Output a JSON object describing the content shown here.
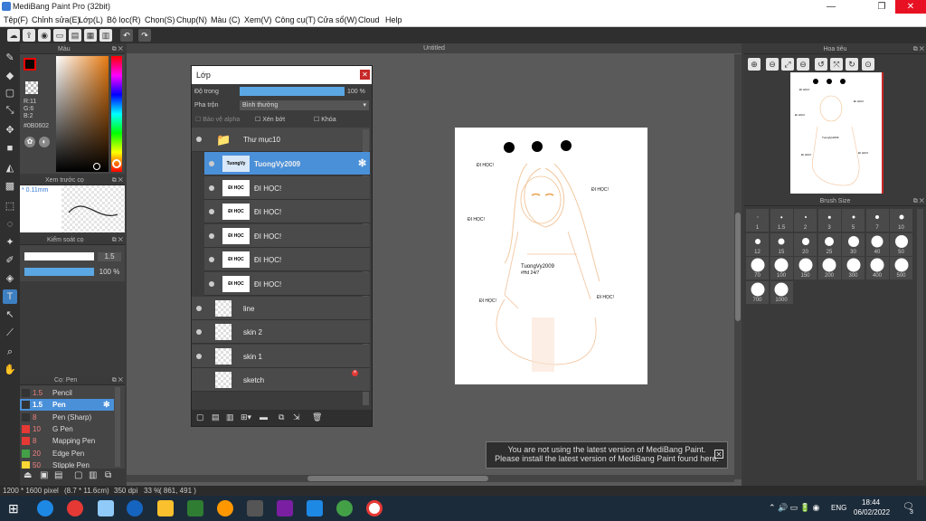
{
  "window": {
    "title": "MediBang Paint Pro (32bit)",
    "min": "—",
    "max": "❐",
    "close": "✕"
  },
  "menu": [
    "Tệp(F)",
    "Chỉnh sửa(E)",
    "Lớp(L)",
    "Bộ lọc(R)",
    "Chọn(S)",
    "Chụp(N)",
    "Màu (C)",
    "Xem(V)",
    "Công cụ(T)",
    "Cửa sổ(W)",
    "Cloud",
    "Help"
  ],
  "color_panel": {
    "title": "Màu",
    "r": "R:11",
    "g": "G:6",
    "b": "B:2",
    "hex": "#0B0602",
    "fg_color": "#0b0602"
  },
  "brush_preview": {
    "title": "Xem trước cọ",
    "size": "0.11mm"
  },
  "brush_control": {
    "title": "Kiểm soát cọ",
    "size_value": "1.5",
    "opacity_value": "100 %"
  },
  "brush_list": {
    "title": "Cọ: Pen",
    "items": [
      {
        "size": "1.5",
        "name": "Pencil",
        "color": "#333333"
      },
      {
        "size": "1.5",
        "name": "Pen",
        "color": "#333333",
        "selected": true
      },
      {
        "size": "8",
        "name": "Pen (Sharp)",
        "color": "#333333"
      },
      {
        "size": "10",
        "name": "G Pen",
        "color": "#e53935"
      },
      {
        "size": "8",
        "name": "Mapping Pen",
        "color": "#e53935"
      },
      {
        "size": "20",
        "name": "Edge Pen",
        "color": "#43a047"
      },
      {
        "size": "50",
        "name": "Stipple Pen",
        "color": "#fdd835"
      }
    ]
  },
  "document": {
    "title": "Untitled"
  },
  "canvas_text": {
    "d1": "ĐI HỌC!",
    "d2": "ĐI HỌC!",
    "d3": "ĐI HỌC!",
    "d4": "ĐI HỌC!",
    "d5": "ĐI HỌC!",
    "sig1": "TuongVy2009",
    "sig2": "#Hd 24/7"
  },
  "layer_window": {
    "title": "Lớp",
    "opacity_label": "Độ trong",
    "opacity_value": "100 %",
    "opacity_fraction": 1.0,
    "blend_label": "Pha trộn",
    "blend_value": "Bình thường",
    "protect_alpha": "Bảo vệ alpha",
    "clipping": "Xén bớt",
    "lock": "Khóa",
    "folder": "Thư mục10",
    "layers": [
      {
        "name": "TuongVy2009",
        "thumb": "TuongVy",
        "selected": true,
        "indent": true
      },
      {
        "name": "ĐI HỌC!",
        "thumb": "ĐI HỌC",
        "indent": true
      },
      {
        "name": "ĐI HỌC!",
        "thumb": "ĐI HỌC",
        "indent": true
      },
      {
        "name": "ĐI HỌC!",
        "thumb": "ĐI HỌC",
        "indent": true
      },
      {
        "name": "ĐI HỌC!",
        "thumb": "ĐI HỌC",
        "indent": true
      },
      {
        "name": "ĐI HỌC!",
        "thumb": "ĐI HỌC",
        "indent": true
      },
      {
        "name": "line",
        "thumb": ""
      },
      {
        "name": "skin 2",
        "thumb": ""
      },
      {
        "name": "skin 1",
        "thumb": ""
      },
      {
        "name": "sketch",
        "thumb": ""
      }
    ]
  },
  "navigator": {
    "title": "Hoa tiêu"
  },
  "brush_size": {
    "title": "Brush Size",
    "sizes": [
      "1",
      "1.5",
      "2",
      "3",
      "5",
      "7",
      "10",
      "12",
      "15",
      "20",
      "25",
      "30",
      "40",
      "50",
      "70",
      "100",
      "150",
      "200",
      "300",
      "400",
      "500",
      "700",
      "1000"
    ]
  },
  "notification": {
    "line1": "You are not using the latest version of MediBang Paint.",
    "line2": "Please install the latest version of MediBang Paint found here."
  },
  "status": {
    "size": "1200 * 1600 pixel",
    "physical": "(8.7 * 11.6cm)",
    "dpi": "350 dpi",
    "zoom": "33 %",
    "coords": "( 861, 491 )"
  },
  "taskbar": {
    "time": "18:44",
    "date": "06/02/2022",
    "lang": "ENG",
    "notif_count": "3"
  }
}
